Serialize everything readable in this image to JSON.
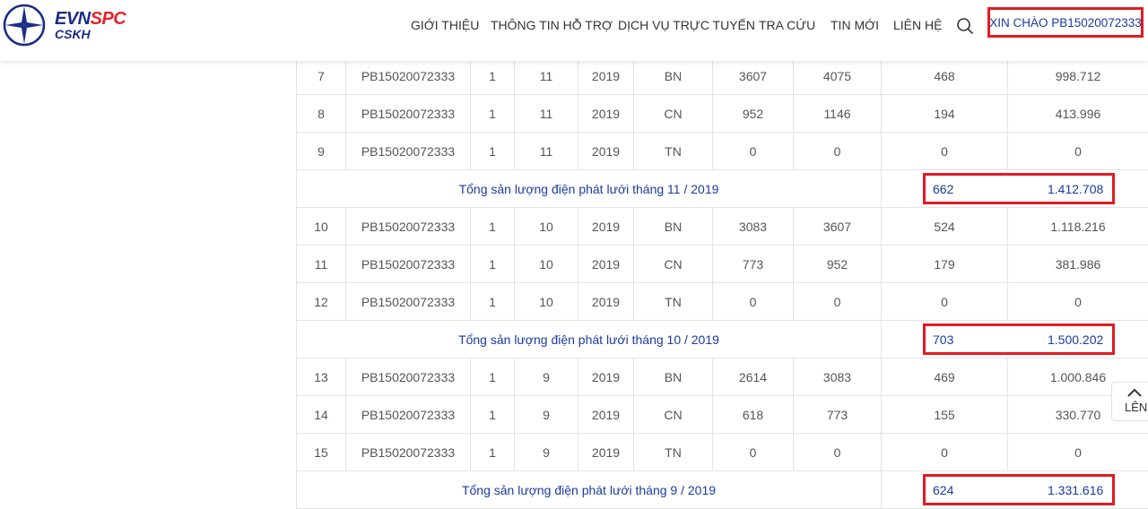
{
  "header": {
    "logo_line1_a": "EVN",
    "logo_line1_b": "SPC",
    "logo_line2": "CSKH",
    "nav": [
      "GIỚI THIỆU",
      "THÔNG TIN HỖ TRỢ",
      "DỊCH VỤ TRỰC TUYẾN",
      "TRA CỨU",
      "TIN MỚI",
      "LIÊN HỆ"
    ],
    "greeting": "XIN CHÀO PB15020072333",
    "colors": {
      "brand_blue": "#1b2c86",
      "brand_red": "#e4232a",
      "link_blue": "#1a3ba0",
      "highlight_red": "#e21b22"
    }
  },
  "table": {
    "rows": [
      {
        "kind": "data",
        "cells": [
          "7",
          "PB15020072333",
          "1",
          "11",
          "2019",
          "BN",
          "3607",
          "4075",
          "468",
          "998.712"
        ]
      },
      {
        "kind": "data",
        "cells": [
          "8",
          "PB15020072333",
          "1",
          "11",
          "2019",
          "CN",
          "952",
          "1146",
          "194",
          "413.996"
        ]
      },
      {
        "kind": "data",
        "cells": [
          "9",
          "PB15020072333",
          "1",
          "11",
          "2019",
          "TN",
          "0",
          "0",
          "0",
          "0"
        ]
      },
      {
        "kind": "total",
        "label": "Tổng sản lượng điện phát lưới tháng 11 / 2019",
        "kwh": "662",
        "amount": "1.412.708"
      },
      {
        "kind": "data",
        "cells": [
          "10",
          "PB15020072333",
          "1",
          "10",
          "2019",
          "BN",
          "3083",
          "3607",
          "524",
          "1.118.216"
        ]
      },
      {
        "kind": "data",
        "cells": [
          "11",
          "PB15020072333",
          "1",
          "10",
          "2019",
          "CN",
          "773",
          "952",
          "179",
          "381.986"
        ]
      },
      {
        "kind": "data",
        "cells": [
          "12",
          "PB15020072333",
          "1",
          "10",
          "2019",
          "TN",
          "0",
          "0",
          "0",
          "0"
        ]
      },
      {
        "kind": "total",
        "label": "Tổng sản lượng điện phát lưới tháng 10 / 2019",
        "kwh": "703",
        "amount": "1.500.202"
      },
      {
        "kind": "data",
        "cells": [
          "13",
          "PB15020072333",
          "1",
          "9",
          "2019",
          "BN",
          "2614",
          "3083",
          "469",
          "1.000.846"
        ]
      },
      {
        "kind": "data",
        "cells": [
          "14",
          "PB15020072333",
          "1",
          "9",
          "2019",
          "CN",
          "618",
          "773",
          "155",
          "330.770"
        ]
      },
      {
        "kind": "data",
        "cells": [
          "15",
          "PB15020072333",
          "1",
          "9",
          "2019",
          "TN",
          "0",
          "0",
          "0",
          "0"
        ]
      },
      {
        "kind": "total",
        "label": "Tổng sản lượng điện phát lưới tháng 9 / 2019",
        "kwh": "624",
        "amount": "1.331.616"
      }
    ]
  },
  "scroll_top": {
    "label": "LÊN"
  }
}
